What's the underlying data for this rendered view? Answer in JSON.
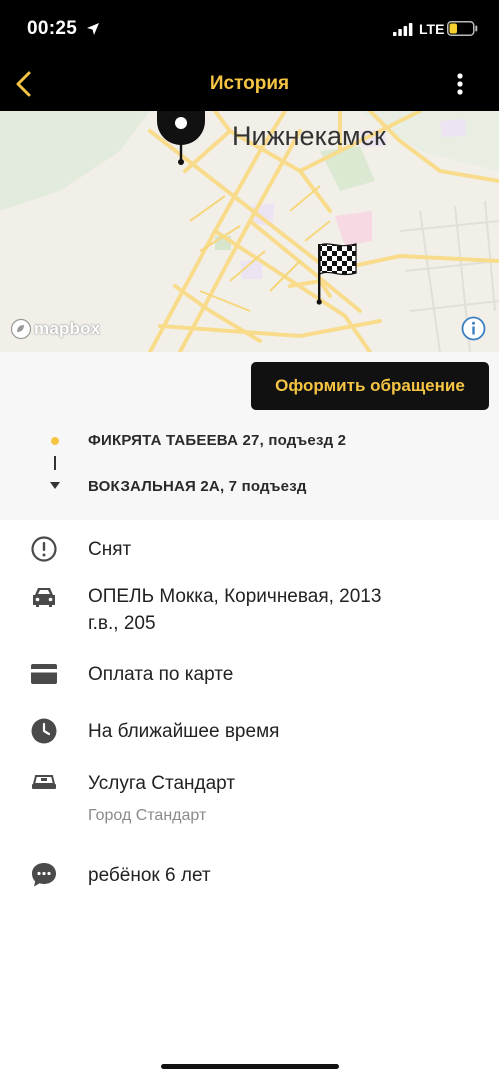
{
  "status_bar": {
    "time": "00:25",
    "network": "LTE",
    "battery_level": 0.3
  },
  "nav": {
    "title": "История",
    "back_icon": "chevron-left-icon",
    "more_icon": "more-vertical-icon"
  },
  "map": {
    "city_label": "Нижнекамск",
    "attribution": "mapbox",
    "info_icon": "info-icon",
    "start_icon": "map-pin-icon",
    "finish_icon": "checkered-flag-icon"
  },
  "actions": {
    "complaint_label": "Оформить обращение"
  },
  "route": {
    "from": "ФИКРЯТА ТАБЕЕВА 27, подъезд 2",
    "to": "ВОКЗАЛЬНАЯ 2А, 7 подъезд"
  },
  "details": {
    "status": "Снят",
    "car_line1": "ОПЕЛЬ Мокка, Коричневая, 2013",
    "car_line2": "г.в., 205",
    "payment": "Оплата по карте",
    "time": "На ближайшее время",
    "service": "Услуга Стандарт",
    "service_sub": "Город Стандарт",
    "comment": "ребёнок 6 лет"
  },
  "colors": {
    "accent": "#f5c443",
    "bar": "#000000",
    "panel": "#f7f7f7",
    "icon": "#4a4a4a"
  }
}
